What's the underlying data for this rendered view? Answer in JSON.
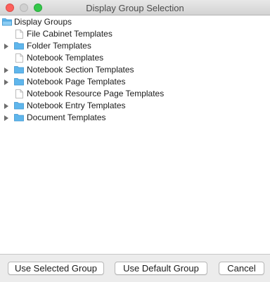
{
  "window": {
    "title": "Display Group Selection"
  },
  "tree": {
    "root": {
      "label": "Display Groups",
      "icon": "folder-open-icon"
    },
    "items": [
      {
        "label": "File Cabinet Templates",
        "icon": "document-icon",
        "expandable": false
      },
      {
        "label": "Folder Templates",
        "icon": "folder-icon",
        "expandable": true
      },
      {
        "label": "Notebook Templates",
        "icon": "document-icon",
        "expandable": false
      },
      {
        "label": "Notebook Section Templates",
        "icon": "folder-icon",
        "expandable": true
      },
      {
        "label": "Notebook Page Templates",
        "icon": "folder-icon",
        "expandable": true
      },
      {
        "label": "Notebook Resource Page Templates",
        "icon": "document-icon",
        "expandable": false
      },
      {
        "label": "Notebook Entry Templates",
        "icon": "folder-icon",
        "expandable": true
      },
      {
        "label": "Document Templates",
        "icon": "folder-icon",
        "expandable": true
      }
    ]
  },
  "buttons": {
    "use_selected": "Use Selected Group",
    "use_default": "Use Default Group",
    "cancel": "Cancel"
  },
  "colors": {
    "folder": "#5fb6ec",
    "close": "#fc605c",
    "zoom": "#34c84a"
  }
}
